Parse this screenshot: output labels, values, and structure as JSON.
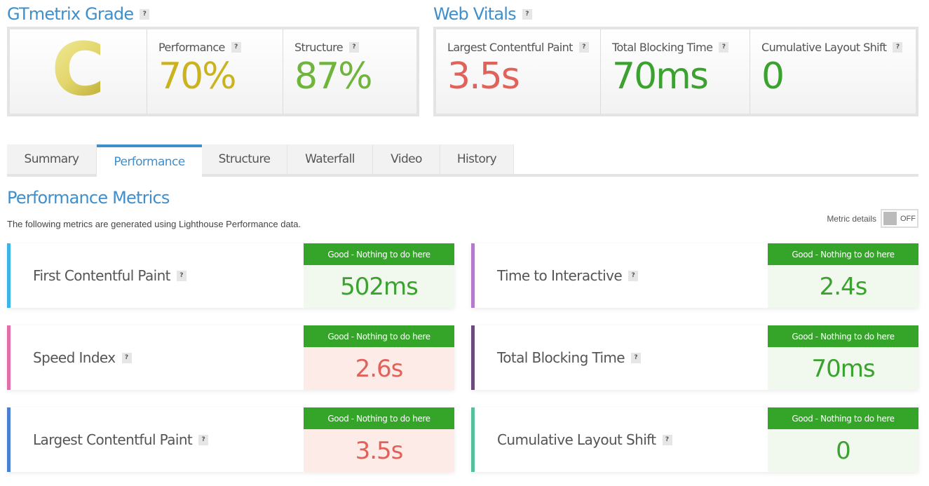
{
  "grade_section": {
    "title": "GTmetrix Grade",
    "grade": "C",
    "grade_color": "#d9cc5a",
    "performance": {
      "label": "Performance",
      "value": "70%",
      "color": "#cbb31f"
    },
    "structure": {
      "label": "Structure",
      "value": "87%",
      "color": "#6fb53b"
    }
  },
  "web_vitals": {
    "title": "Web Vitals",
    "items": [
      {
        "label": "Largest Contentful Paint",
        "value": "3.5s",
        "color": "#e0625a"
      },
      {
        "label": "Total Blocking Time",
        "value": "70ms",
        "color": "#3ba22f"
      },
      {
        "label": "Cumulative Layout Shift",
        "value": "0",
        "color": "#3ba22f"
      }
    ]
  },
  "tabs": [
    {
      "label": "Summary",
      "active": false
    },
    {
      "label": "Performance",
      "active": true
    },
    {
      "label": "Structure",
      "active": false
    },
    {
      "label": "Waterfall",
      "active": false
    },
    {
      "label": "Video",
      "active": false
    },
    {
      "label": "History",
      "active": false
    }
  ],
  "performance_metrics": {
    "title": "Performance Metrics",
    "subtitle": "The following metrics are generated using Lighthouse Performance data.",
    "toggle": {
      "label": "Metric details",
      "state": "OFF"
    },
    "help_glyph": "?",
    "metrics": [
      {
        "name": "First Contentful Paint",
        "status": "Good - Nothing to do here",
        "value": "502ms",
        "accent": "#3bb4e8",
        "rating": "good"
      },
      {
        "name": "Time to Interactive",
        "status": "Good - Nothing to do here",
        "value": "2.4s",
        "accent": "#b27ccb",
        "rating": "good"
      },
      {
        "name": "Speed Index",
        "status": "Good - Nothing to do here",
        "value": "2.6s",
        "accent": "#e46fa8",
        "rating": "bad"
      },
      {
        "name": "Total Blocking Time",
        "status": "Good - Nothing to do here",
        "value": "70ms",
        "accent": "#6b4b7a",
        "rating": "good"
      },
      {
        "name": "Largest Contentful Paint",
        "status": "Good - Nothing to do here",
        "value": "3.5s",
        "accent": "#4a7fd6",
        "rating": "bad"
      },
      {
        "name": "Cumulative Layout Shift",
        "status": "Good - Nothing to do here",
        "value": "0",
        "accent": "#54c09c",
        "rating": "good"
      }
    ]
  }
}
